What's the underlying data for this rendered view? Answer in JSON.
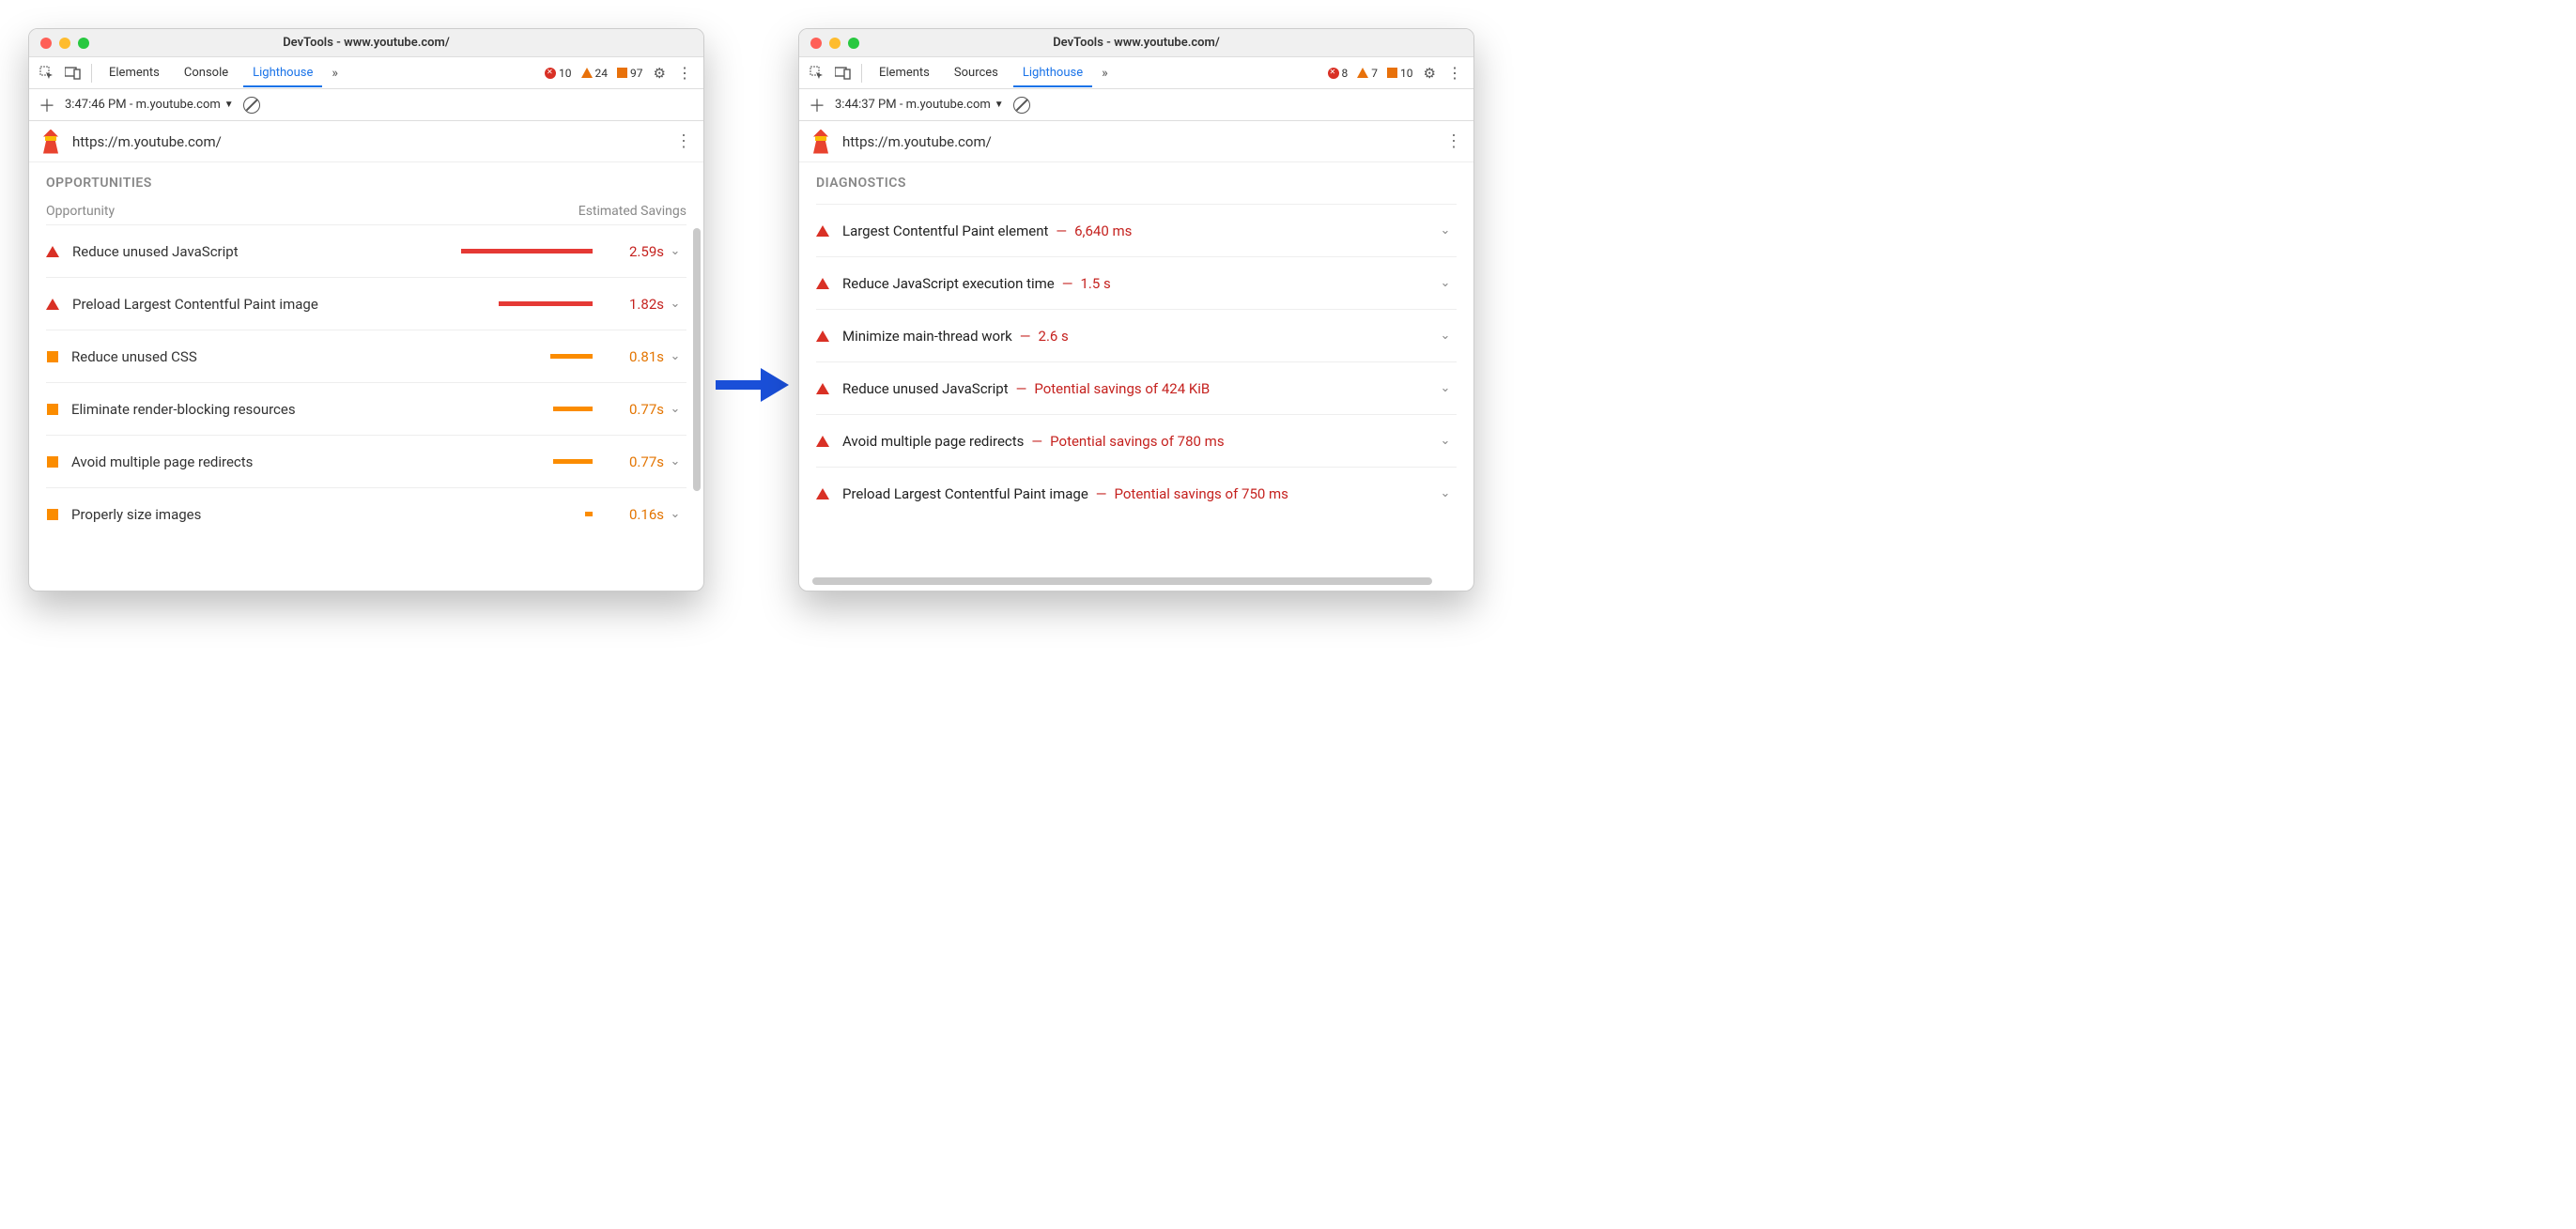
{
  "left": {
    "title": "DevTools - www.youtube.com/",
    "tabs": {
      "a": "Elements",
      "b": "Console",
      "active": "Lighthouse"
    },
    "counts": {
      "errors": "10",
      "warnings": "24",
      "info": "97"
    },
    "sub": {
      "timestamp": "3:47:46 PM - m.youtube.com"
    },
    "url": "https://m.youtube.com/",
    "section": "OPPORTUNITIES",
    "colA": "Opportunity",
    "colB": "Estimated Savings",
    "rows": [
      {
        "label": "Reduce unused JavaScript",
        "value": "2.59s",
        "sev": "red",
        "barW": 140
      },
      {
        "label": "Preload Largest Contentful Paint image",
        "value": "1.82s",
        "sev": "red",
        "barW": 100
      },
      {
        "label": "Reduce unused CSS",
        "value": "0.81s",
        "sev": "orange",
        "barW": 45
      },
      {
        "label": "Eliminate render-blocking resources",
        "value": "0.77s",
        "sev": "orange",
        "barW": 42
      },
      {
        "label": "Avoid multiple page redirects",
        "value": "0.77s",
        "sev": "orange",
        "barW": 42
      },
      {
        "label": "Properly size images",
        "value": "0.16s",
        "sev": "orange",
        "barW": 8
      }
    ]
  },
  "right": {
    "title": "DevTools - www.youtube.com/",
    "tabs": {
      "a": "Elements",
      "b": "Sources",
      "active": "Lighthouse"
    },
    "counts": {
      "errors": "8",
      "warnings": "7",
      "info": "10"
    },
    "sub": {
      "timestamp": "3:44:37 PM - m.youtube.com"
    },
    "url": "https://m.youtube.com/",
    "section": "DIAGNOSTICS",
    "rows": [
      {
        "label": "Largest Contentful Paint element",
        "value": "6,640 ms"
      },
      {
        "label": "Reduce JavaScript execution time",
        "value": "1.5 s"
      },
      {
        "label": "Minimize main-thread work",
        "value": "2.6 s"
      },
      {
        "label": "Reduce unused JavaScript",
        "value": "Potential savings of 424 KiB"
      },
      {
        "label": "Avoid multiple page redirects",
        "value": "Potential savings of 780 ms"
      },
      {
        "label": "Preload Largest Contentful Paint image",
        "value": "Potential savings of 750 ms"
      }
    ]
  }
}
